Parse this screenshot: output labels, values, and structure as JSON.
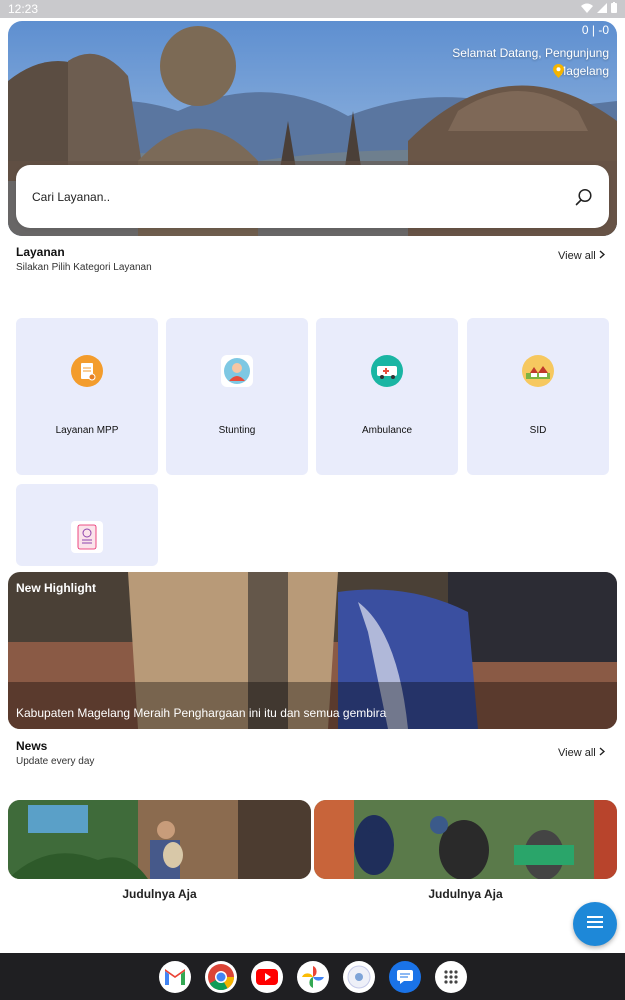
{
  "status_bar": {
    "time": "12:23"
  },
  "hero": {
    "counter": "0 | -0",
    "welcome": "Selamat Datang, Pengunjung",
    "location": "Magelang"
  },
  "search": {
    "placeholder": "Cari Layanan.."
  },
  "services": {
    "title": "Layanan",
    "subtitle": "Silakan Pilih Kategori Layanan",
    "view_all": "View all",
    "items": [
      {
        "label": "Layanan MPP",
        "icon": "document-clipboard-icon"
      },
      {
        "label": "Stunting",
        "icon": "mother-baby-icon"
      },
      {
        "label": "Ambulance",
        "icon": "ambulance-icon"
      },
      {
        "label": "SID",
        "icon": "village-icon"
      },
      {
        "label": "",
        "icon": "passport-document-icon"
      }
    ]
  },
  "highlight": {
    "title": "New Highlight",
    "caption": "Kabupaten Magelang Meraih Penghargaan ini itu dan semua gembira"
  },
  "news": {
    "title": "News",
    "subtitle": "Update every day",
    "view_all": "View all",
    "items": [
      {
        "title": "Judulnya Aja"
      },
      {
        "title": "Judulnya Aja"
      }
    ]
  },
  "taskbar": {
    "apps": [
      "gmail-icon",
      "chrome-icon",
      "youtube-icon",
      "photos-icon",
      "app-icon",
      "messages-icon",
      "app-drawer-icon"
    ]
  },
  "colors": {
    "accent": "#1e88d8",
    "card_bg": "#e9ecfb"
  }
}
